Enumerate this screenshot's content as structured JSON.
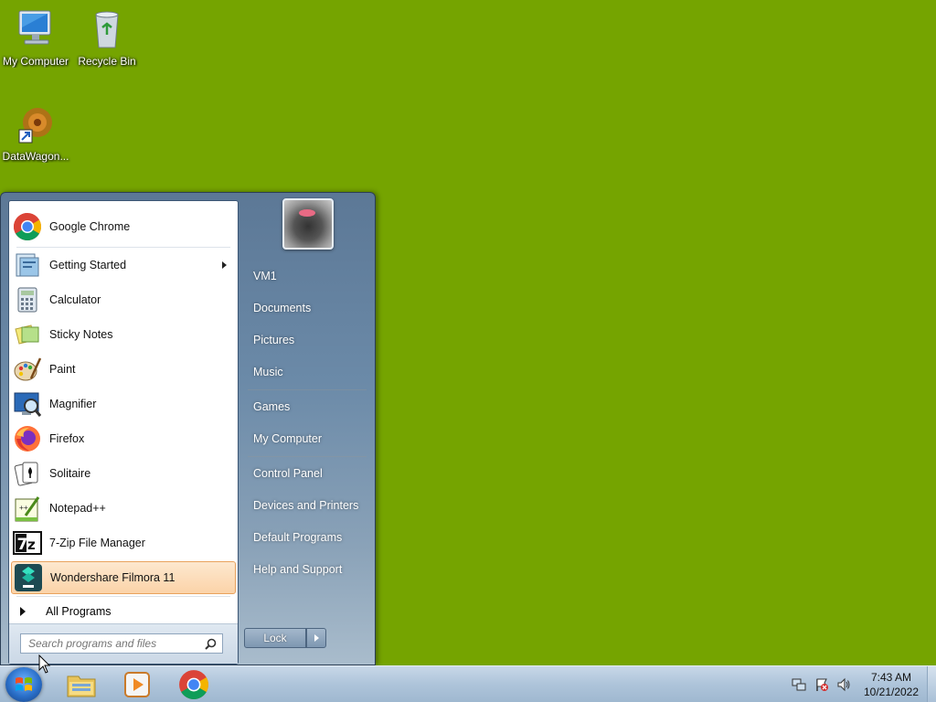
{
  "desktop": {
    "icons": [
      {
        "label": "My Computer",
        "icon": "computer-icon"
      },
      {
        "label": "Recycle Bin",
        "icon": "recycle-bin-icon"
      },
      {
        "label": "DataWagon...",
        "icon": "datawagon-shortcut-icon"
      }
    ],
    "background_color": "#75a400"
  },
  "start_menu": {
    "programs": [
      {
        "label": "Google Chrome",
        "icon": "chrome-icon"
      },
      {
        "label": "Getting Started",
        "icon": "getting-started-icon",
        "has_submenu": true
      },
      {
        "label": "Calculator",
        "icon": "calculator-icon"
      },
      {
        "label": "Sticky Notes",
        "icon": "sticky-notes-icon"
      },
      {
        "label": "Paint",
        "icon": "paint-icon"
      },
      {
        "label": "Magnifier",
        "icon": "magnifier-icon"
      },
      {
        "label": "Firefox",
        "icon": "firefox-icon"
      },
      {
        "label": "Solitaire",
        "icon": "solitaire-icon"
      },
      {
        "label": "Notepad++",
        "icon": "notepadpp-icon"
      },
      {
        "label": "7-Zip File Manager",
        "icon": "7zip-icon"
      },
      {
        "label": "Wondershare Filmora 11",
        "icon": "filmora-icon",
        "highlighted": true
      }
    ],
    "all_programs_label": "All Programs",
    "search_placeholder": "Search programs and files",
    "right_links": {
      "user": "VM1",
      "documents": "Documents",
      "pictures": "Pictures",
      "music": "Music",
      "games": "Games",
      "my_computer": "My Computer",
      "control_panel": "Control Panel",
      "devices_printers": "Devices and Printers",
      "default_programs": "Default Programs",
      "help_support": "Help and Support"
    },
    "lock_label": "Lock"
  },
  "taskbar": {
    "pinned": [
      {
        "name": "windows-explorer-icon"
      },
      {
        "name": "media-player-icon"
      },
      {
        "name": "chrome-icon"
      }
    ],
    "clock_time": "7:43 AM",
    "clock_date": "10/21/2022"
  }
}
